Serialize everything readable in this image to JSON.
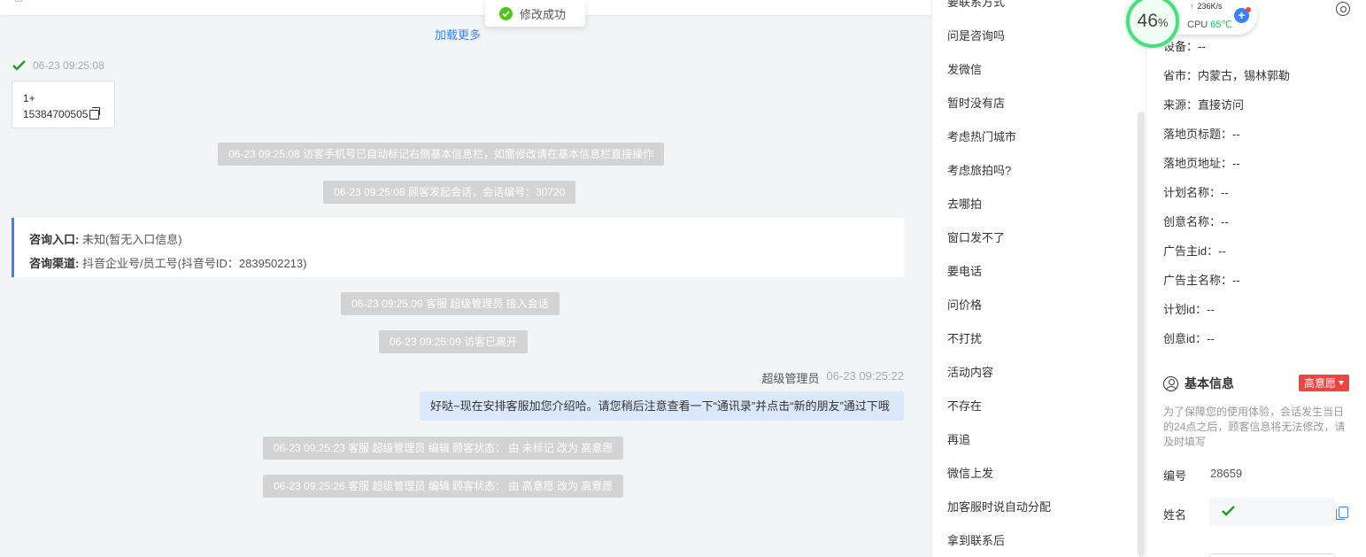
{
  "toast": {
    "message": "修改成功",
    "icon": "check-circle-icon"
  },
  "chat": {
    "load_more": "加载更多",
    "visitor": {
      "time": "06-23 09:25:08",
      "card_line1": "1+",
      "card_phone": "15384700505"
    },
    "system_messages": [
      "06-23 09:25:08 访客手机号已自动标记右侧基本信息栏，如需修改请在基本信息栏直接操作",
      "06-23 09:25:08 顾客发起会话，会话编号：30720",
      "06-23 09:25:09 客服 超级管理员 接入会话",
      "06-23 09:25:09 访客已离开",
      "06-23 09:25:23 客服 超级管理员 编辑 顾客状态： 由 未标记 改为 高意愿",
      "06-23 09:25:26 客服 超级管理员 编辑 顾客状态： 由 高意愿 改为 高意愿"
    ],
    "entry": {
      "entry_label": "咨询入口:",
      "entry_value": "未知(暂无入口信息)",
      "channel_label": "咨询渠道:",
      "channel_value": "抖音企业号/员工号(抖音号ID：2839502213)"
    },
    "agent_message": {
      "sender": "超级管理员",
      "time": "06-23 09:25:22",
      "text": "好哒~现在安排客服加您介绍哈。请您稍后注意查看一下“通讯录”并点击“新的朋友”通过下哦"
    }
  },
  "quick_replies": [
    "要联系方式",
    "问是咨询吗",
    "发微信",
    "暂时没有店",
    "考虑热门城市",
    "考虑旅拍吗?",
    "去哪拍",
    "窗口发不了",
    "要电话",
    "问价格",
    "不打扰",
    "活动内容",
    "不存在",
    "再追",
    "微信上发",
    "加客服时说自动分配",
    "拿到联系后"
  ],
  "visitor_info": [
    "设备：--",
    "省市：内蒙古，锡林郭勒",
    "来源：直接访问",
    "落地页标题：--",
    "落地页地址：--",
    "计划名称：--",
    "创意名称：--",
    "广告主id：--",
    "广告主名称：--",
    "计划id：--",
    "创意id：--"
  ],
  "basic_info": {
    "title": "基本信息",
    "intent_badge": "高意愿",
    "notice": "为了保障您的使用体验，会话发生当日的24点之后，顾客信息将无法修改，请及时填写",
    "id_label": "编号",
    "id_value": "28659",
    "name_label": "姓名"
  },
  "cpu_widget": {
    "percent": "46",
    "percent_unit": "%",
    "net_speed": "236K/s",
    "cpu_label": "CPU",
    "temperature": "65℃"
  },
  "colors": {
    "accent": "#3b82f6",
    "success": "#52c41a",
    "badge_red": "#ef4444",
    "system_msg_bg": "#d3d3d3",
    "agent_bubble": "#dbe8fb"
  }
}
